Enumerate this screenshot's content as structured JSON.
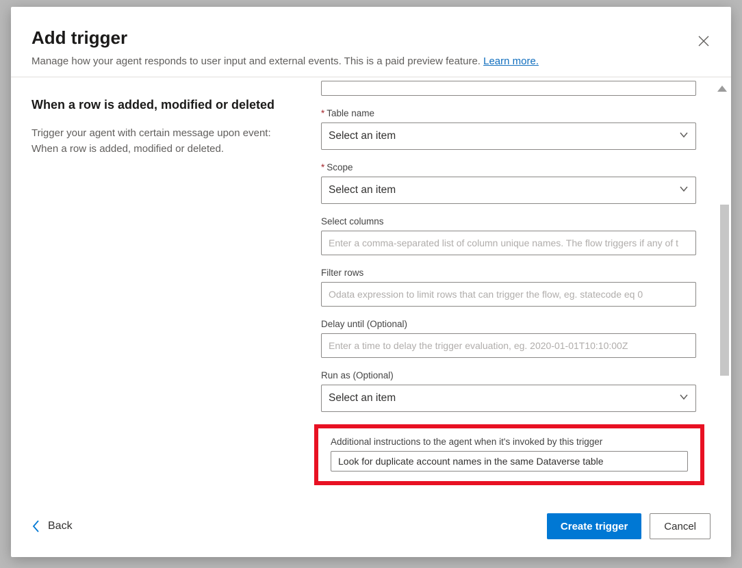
{
  "header": {
    "title": "Add trigger",
    "subtitle_text": "Manage how your agent responds to user input and external events. This is a paid preview feature. ",
    "learn_more": "Learn more."
  },
  "left": {
    "title": "When a row is added, modified or deleted",
    "desc": "Trigger your agent with certain message upon event: When a row is added, modified or deleted."
  },
  "form": {
    "table_name": {
      "label": "Table name",
      "selected": "Select an item"
    },
    "scope": {
      "label": "Scope",
      "selected": "Select an item"
    },
    "select_columns": {
      "label": "Select columns",
      "placeholder": "Enter a comma-separated list of column unique names. The flow triggers if any of t",
      "value": ""
    },
    "filter_rows": {
      "label": "Filter rows",
      "placeholder": "Odata expression to limit rows that can trigger the flow, eg. statecode eq 0",
      "value": ""
    },
    "delay_until": {
      "label": "Delay until (Optional)",
      "placeholder": "Enter a time to delay the trigger evaluation, eg. 2020-01-01T10:10:00Z",
      "value": ""
    },
    "run_as": {
      "label": "Run as (Optional)",
      "selected": "Select an item"
    },
    "instructions": {
      "label": "Additional instructions to the agent when it's invoked by this trigger",
      "value": "Look for duplicate account names in the same Dataverse table"
    }
  },
  "footer": {
    "back": "Back",
    "create": "Create trigger",
    "cancel": "Cancel"
  }
}
